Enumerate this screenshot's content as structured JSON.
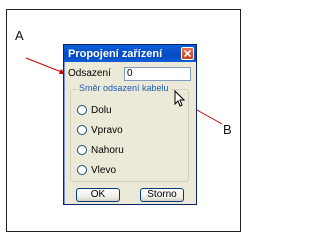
{
  "callouts": {
    "a": "A",
    "b": "B"
  },
  "dialog": {
    "title": "Propojení zařízení",
    "offset_label": "Odsazení",
    "offset_value": "0",
    "group_title": "Směr odsazení kabelu",
    "options": [
      {
        "label": "Dolu",
        "selected": false
      },
      {
        "label": "Vpravo",
        "selected": false
      },
      {
        "label": "Nahoru",
        "selected": false
      },
      {
        "label": "Vlevo",
        "selected": false
      }
    ],
    "ok_label": "OK",
    "cancel_label": "Storno"
  },
  "colors": {
    "titlebar": "#0a5fd8",
    "dialog_bg": "#ece9d8",
    "close_button": "#d9532c",
    "group_title": "#1d5ab5",
    "arrows": "#cc0000"
  },
  "icons": {
    "close": "close-icon",
    "cursor": "mouse-cursor-icon"
  }
}
